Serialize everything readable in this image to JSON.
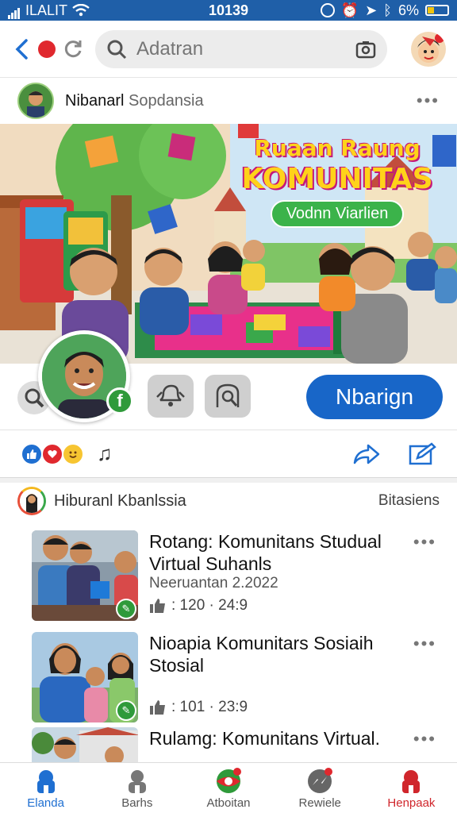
{
  "status": {
    "carrier": "ILALIT",
    "time": "10139",
    "battery": "6%"
  },
  "topbar": {
    "search_placeholder": "Adatran"
  },
  "post": {
    "author": "Nibanarl",
    "group": "Sopdansia"
  },
  "banner": {
    "title_line1": "Ruaan Raung",
    "title_line2": "KOMUNITAS",
    "pill": "Vodnn Viarlien"
  },
  "actions": {
    "primary_label": "Nbarign",
    "badge": "f"
  },
  "feed": {
    "title": "Hiburanl Kbanlssia",
    "link": "Bitasiens",
    "items": [
      {
        "title": "Rotang: Komunitans Studual Virtual Suhanls",
        "date": "Neeruantan 2.2022",
        "stats": ": 120 · 24:9"
      },
      {
        "title": "Nioapia Komunitars Sosiaih Stosial",
        "date": "",
        "stats": ": 101 · 23:9"
      },
      {
        "title": "Rulamg: Komunitans Virtual.",
        "date": "",
        "stats": ""
      }
    ]
  },
  "nav": [
    {
      "label": "Elanda",
      "color": "#1f6fd1"
    },
    {
      "label": "Barhs",
      "color": "#555555"
    },
    {
      "label": "Atboitan",
      "color": "#555555"
    },
    {
      "label": "Rewiele",
      "color": "#555555"
    },
    {
      "label": "Henpaak",
      "color": "#d0262c"
    }
  ],
  "colors": {
    "accent": "#1866c8",
    "statusbar": "#1f5fa8",
    "badge_green": "#2f9a3a"
  }
}
